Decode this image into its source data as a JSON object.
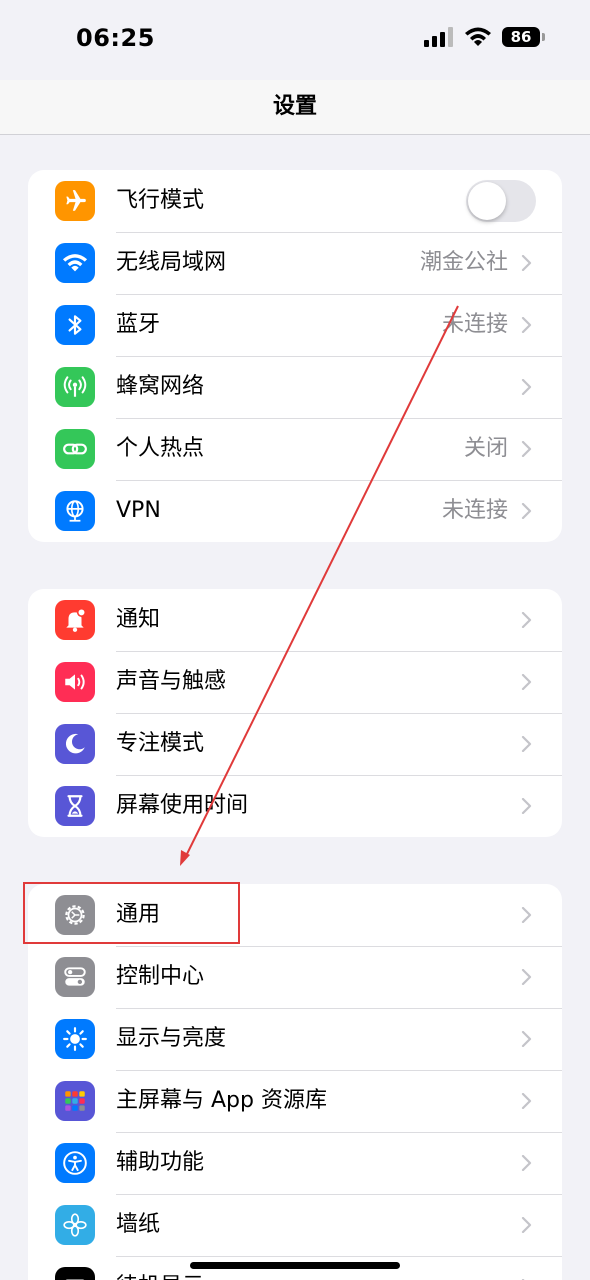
{
  "status_bar": {
    "time": "06:25",
    "battery": "86"
  },
  "nav": {
    "title": "设置"
  },
  "groups": [
    {
      "items": [
        {
          "name": "airplane",
          "label": "飞行模式",
          "color": "#ff9500",
          "toggle": true,
          "toggle_on": false
        },
        {
          "name": "wifi",
          "label": "无线局域网",
          "value": "潮金公社",
          "color": "#007aff"
        },
        {
          "name": "bluetooth",
          "label": "蓝牙",
          "value": "未连接",
          "color": "#007aff"
        },
        {
          "name": "cellular",
          "label": "蜂窝网络",
          "value": "",
          "color": "#34c759"
        },
        {
          "name": "hotspot",
          "label": "个人热点",
          "value": "关闭",
          "color": "#34c759"
        },
        {
          "name": "vpn",
          "label": "VPN",
          "value": "未连接",
          "color": "#007aff"
        }
      ]
    },
    {
      "items": [
        {
          "name": "notifications",
          "label": "通知",
          "color": "#ff3b30"
        },
        {
          "name": "sounds",
          "label": "声音与触感",
          "color": "#ff2d55"
        },
        {
          "name": "focus",
          "label": "专注模式",
          "color": "#5856d6"
        },
        {
          "name": "screen-time",
          "label": "屏幕使用时间",
          "color": "#5856d6"
        }
      ]
    },
    {
      "items": [
        {
          "name": "general",
          "label": "通用",
          "color": "#8e8e93"
        },
        {
          "name": "control-center",
          "label": "控制中心",
          "color": "#8e8e93"
        },
        {
          "name": "display",
          "label": "显示与亮度",
          "color": "#007aff"
        },
        {
          "name": "home-screen",
          "label": "主屏幕与 App 资源库",
          "color": "#5856d6"
        },
        {
          "name": "accessibility",
          "label": "辅助功能",
          "color": "#007aff"
        },
        {
          "name": "wallpaper",
          "label": "墙纸",
          "color": "#32ade6"
        },
        {
          "name": "standby",
          "label": "待机显示",
          "color": "#000000"
        }
      ]
    }
  ],
  "annotation": {
    "color": "#e03a3a"
  }
}
